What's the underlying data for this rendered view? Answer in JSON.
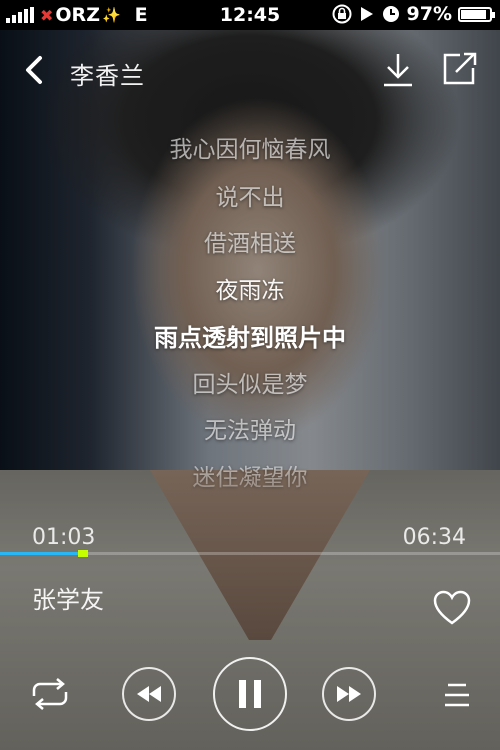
{
  "status_bar": {
    "carrier": "ORZ",
    "network": "E",
    "time": "12:45",
    "battery": "97%",
    "battery_level": 0.97,
    "icons": [
      "signal-icon",
      "lock-rotation-icon",
      "play-icon",
      "alarm-icon",
      "battery-icon"
    ]
  },
  "header": {
    "title": "李香兰",
    "icons": [
      "back-icon",
      "download-icon",
      "share-icon"
    ]
  },
  "lyrics": {
    "lines": [
      "我心因何恼春风",
      "说不出",
      "借酒相送",
      "夜雨冻",
      "雨点透射到照片中",
      "回头似是梦",
      "无法弹动",
      "迷住凝望你"
    ],
    "current_index": 4
  },
  "player": {
    "elapsed": "01:03",
    "total": "06:34",
    "progress": 0.16,
    "artist": "张学友"
  },
  "controls": {
    "icons": [
      "loop-icon",
      "previous-icon",
      "pause-icon",
      "next-icon",
      "playlist-icon",
      "heart-icon"
    ]
  },
  "colors": {
    "progress_fill": "#29b6f6",
    "progress_knob": "#c6ff00",
    "carrier_logo": "#e53935"
  }
}
